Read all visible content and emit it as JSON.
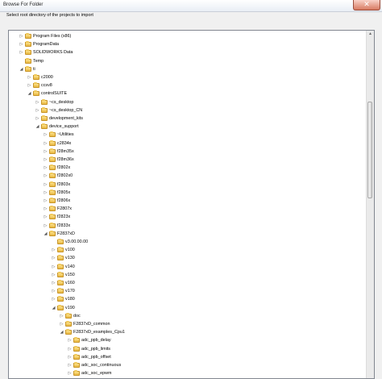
{
  "window": {
    "title": "Browse For Folder",
    "close_glyph": "✕"
  },
  "instruction": "Select root directory of the projects to import",
  "icons": {
    "collapsed": "▷",
    "expanded": "◢",
    "folder": "folder-icon",
    "scroll_up": "▲"
  },
  "tree": [
    {
      "label": "Program Files (x86)",
      "level": 0,
      "state": "collapsed"
    },
    {
      "label": "ProgramData",
      "level": 0,
      "state": "collapsed"
    },
    {
      "label": "SOLIDWORKS Data",
      "level": 0,
      "state": "collapsed"
    },
    {
      "label": "Temp",
      "level": 0,
      "state": "none"
    },
    {
      "label": "ti",
      "level": 0,
      "state": "expanded"
    },
    {
      "label": "c2000",
      "level": 1,
      "state": "collapsed"
    },
    {
      "label": "ccsv8",
      "level": 1,
      "state": "collapsed"
    },
    {
      "label": "controlSUITE",
      "level": 1,
      "state": "expanded"
    },
    {
      "label": "~cs_desktop",
      "level": 2,
      "state": "collapsed"
    },
    {
      "label": "~cs_desktop_CN",
      "level": 2,
      "state": "collapsed"
    },
    {
      "label": "development_kits",
      "level": 2,
      "state": "collapsed"
    },
    {
      "label": "device_support",
      "level": 2,
      "state": "expanded"
    },
    {
      "label": "~Utilities",
      "level": 3,
      "state": "collapsed"
    },
    {
      "label": "c2834x",
      "level": 3,
      "state": "collapsed"
    },
    {
      "label": "f28m35x",
      "level": 3,
      "state": "collapsed"
    },
    {
      "label": "f28m36x",
      "level": 3,
      "state": "collapsed"
    },
    {
      "label": "f2802x",
      "level": 3,
      "state": "collapsed"
    },
    {
      "label": "f2802x0",
      "level": 3,
      "state": "collapsed"
    },
    {
      "label": "f2803x",
      "level": 3,
      "state": "collapsed"
    },
    {
      "label": "f2805x",
      "level": 3,
      "state": "collapsed"
    },
    {
      "label": "f2806x",
      "level": 3,
      "state": "collapsed"
    },
    {
      "label": "F2807x",
      "level": 3,
      "state": "collapsed"
    },
    {
      "label": "f2823x",
      "level": 3,
      "state": "collapsed"
    },
    {
      "label": "f2833x",
      "level": 3,
      "state": "collapsed"
    },
    {
      "label": "F2837xD",
      "level": 3,
      "state": "expanded"
    },
    {
      "label": "v3.00.00.00",
      "level": 4,
      "state": "none"
    },
    {
      "label": "v100",
      "level": 4,
      "state": "collapsed"
    },
    {
      "label": "v130",
      "level": 4,
      "state": "collapsed"
    },
    {
      "label": "v140",
      "level": 4,
      "state": "collapsed"
    },
    {
      "label": "v150",
      "level": 4,
      "state": "collapsed"
    },
    {
      "label": "v160",
      "level": 4,
      "state": "collapsed"
    },
    {
      "label": "v170",
      "level": 4,
      "state": "collapsed"
    },
    {
      "label": "v180",
      "level": 4,
      "state": "collapsed"
    },
    {
      "label": "v190",
      "level": 4,
      "state": "expanded"
    },
    {
      "label": "doc",
      "level": 5,
      "state": "collapsed"
    },
    {
      "label": "F2837xD_common",
      "level": 5,
      "state": "collapsed"
    },
    {
      "label": "F2837xD_examples_Cpu1",
      "level": 5,
      "state": "expanded"
    },
    {
      "label": "adc_ppb_delay",
      "level": 6,
      "state": "collapsed"
    },
    {
      "label": "adc_ppb_limits",
      "level": 6,
      "state": "collapsed"
    },
    {
      "label": "adc_ppb_offset",
      "level": 6,
      "state": "collapsed"
    },
    {
      "label": "adc_soc_continuous",
      "level": 6,
      "state": "collapsed"
    },
    {
      "label": "adc_soc_epwm",
      "level": 6,
      "state": "collapsed"
    }
  ]
}
